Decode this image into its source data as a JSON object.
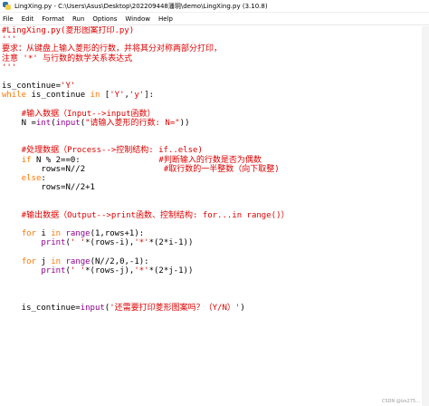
{
  "window": {
    "title": "LingXing.py - C:\\Users\\Asus\\Desktop\\202209448潘玥\\demo\\LingXing.py (3.10.8)"
  },
  "menu": [
    "File",
    "Edit",
    "Format",
    "Run",
    "Options",
    "Window",
    "Help"
  ],
  "code": [
    [
      {
        "t": "#LingXing.py(菱形图案打印.py)",
        "c": "c"
      }
    ],
    [
      {
        "t": "'''",
        "c": "c"
      }
    ],
    [
      {
        "t": "要求：从键盘上输入菱形的行数，并将其分对称两部分打印，",
        "c": "c"
      }
    ],
    [
      {
        "t": "注意 '*' 与行数的数学关系表达式",
        "c": "c"
      }
    ],
    [
      {
        "t": "'''",
        "c": "c"
      }
    ],
    [],
    [
      {
        "t": "is_continue=",
        "c": "n"
      },
      {
        "t": "'Y'",
        "c": "c"
      }
    ],
    [
      {
        "t": "while",
        "c": "k"
      },
      {
        "t": " is_continue ",
        "c": "n"
      },
      {
        "t": "in",
        "c": "k"
      },
      {
        "t": " [",
        "c": "n"
      },
      {
        "t": "'Y'",
        "c": "c"
      },
      {
        "t": ",",
        "c": "n"
      },
      {
        "t": "'y'",
        "c": "c"
      },
      {
        "t": "]:",
        "c": "n"
      }
    ],
    [],
    [
      {
        "t": "    #输入数据（Input-->input函数）",
        "c": "c"
      }
    ],
    [
      {
        "t": "    N =",
        "c": "n"
      },
      {
        "t": "int",
        "c": "b"
      },
      {
        "t": "(",
        "c": "n"
      },
      {
        "t": "input",
        "c": "b"
      },
      {
        "t": "(",
        "c": "n"
      },
      {
        "t": "\"请输入菱形的行数: N=\"",
        "c": "c"
      },
      {
        "t": "))",
        "c": "n"
      }
    ],
    [],
    [],
    [
      {
        "t": "    #处理数据（Process-->控制结构: if..else)",
        "c": "c"
      }
    ],
    [
      {
        "t": "    ",
        "c": "n"
      },
      {
        "t": "if",
        "c": "k"
      },
      {
        "t": " N % 2==0:                ",
        "c": "n"
      },
      {
        "t": "#判断输入的行数是否为偶数",
        "c": "c"
      }
    ],
    [
      {
        "t": "        rows=N//2                ",
        "c": "n"
      },
      {
        "t": "#取行数的一半整数（向下取整)",
        "c": "c"
      }
    ],
    [
      {
        "t": "    ",
        "c": "n"
      },
      {
        "t": "else",
        "c": "k"
      },
      {
        "t": ":",
        "c": "n"
      }
    ],
    [
      {
        "t": "        rows=N//2+1",
        "c": "n"
      }
    ],
    [],
    [],
    [
      {
        "t": "    #输出数据（Output-->print函数、控制结构: for...in range()）",
        "c": "c"
      }
    ],
    [],
    [
      {
        "t": "    ",
        "c": "n"
      },
      {
        "t": "for",
        "c": "k"
      },
      {
        "t": " i ",
        "c": "n"
      },
      {
        "t": "in",
        "c": "k"
      },
      {
        "t": " ",
        "c": "n"
      },
      {
        "t": "range",
        "c": "b"
      },
      {
        "t": "(1,rows+1):",
        "c": "n"
      }
    ],
    [
      {
        "t": "        ",
        "c": "n"
      },
      {
        "t": "print",
        "c": "b"
      },
      {
        "t": "(",
        "c": "n"
      },
      {
        "t": "' '",
        "c": "c"
      },
      {
        "t": "*(rows-i),",
        "c": "n"
      },
      {
        "t": "'*'",
        "c": "c"
      },
      {
        "t": "*(2*i-1))",
        "c": "n"
      }
    ],
    [],
    [
      {
        "t": "    ",
        "c": "n"
      },
      {
        "t": "for",
        "c": "k"
      },
      {
        "t": " j ",
        "c": "n"
      },
      {
        "t": "in",
        "c": "k"
      },
      {
        "t": " ",
        "c": "n"
      },
      {
        "t": "range",
        "c": "b"
      },
      {
        "t": "(N//2,0,-1):",
        "c": "n"
      }
    ],
    [
      {
        "t": "        ",
        "c": "n"
      },
      {
        "t": "print",
        "c": "b"
      },
      {
        "t": "(",
        "c": "n"
      },
      {
        "t": "' '",
        "c": "c"
      },
      {
        "t": "*(rows-j),",
        "c": "n"
      },
      {
        "t": "'*'",
        "c": "c"
      },
      {
        "t": "*(2*j-1))",
        "c": "n"
      }
    ],
    [],
    [],
    [],
    [
      {
        "t": "    is_continue=",
        "c": "n"
      },
      {
        "t": "input",
        "c": "b"
      },
      {
        "t": "(",
        "c": "n"
      },
      {
        "t": "'还需要打印菱形图案吗？（Y/N）'",
        "c": "c"
      },
      {
        "t": ")",
        "c": "n"
      }
    ]
  ],
  "colors": {
    "comment": "#dd0000",
    "keyword": "#ff7700",
    "builtin": "#900090"
  },
  "watermark": "CSDN @lzx275..."
}
